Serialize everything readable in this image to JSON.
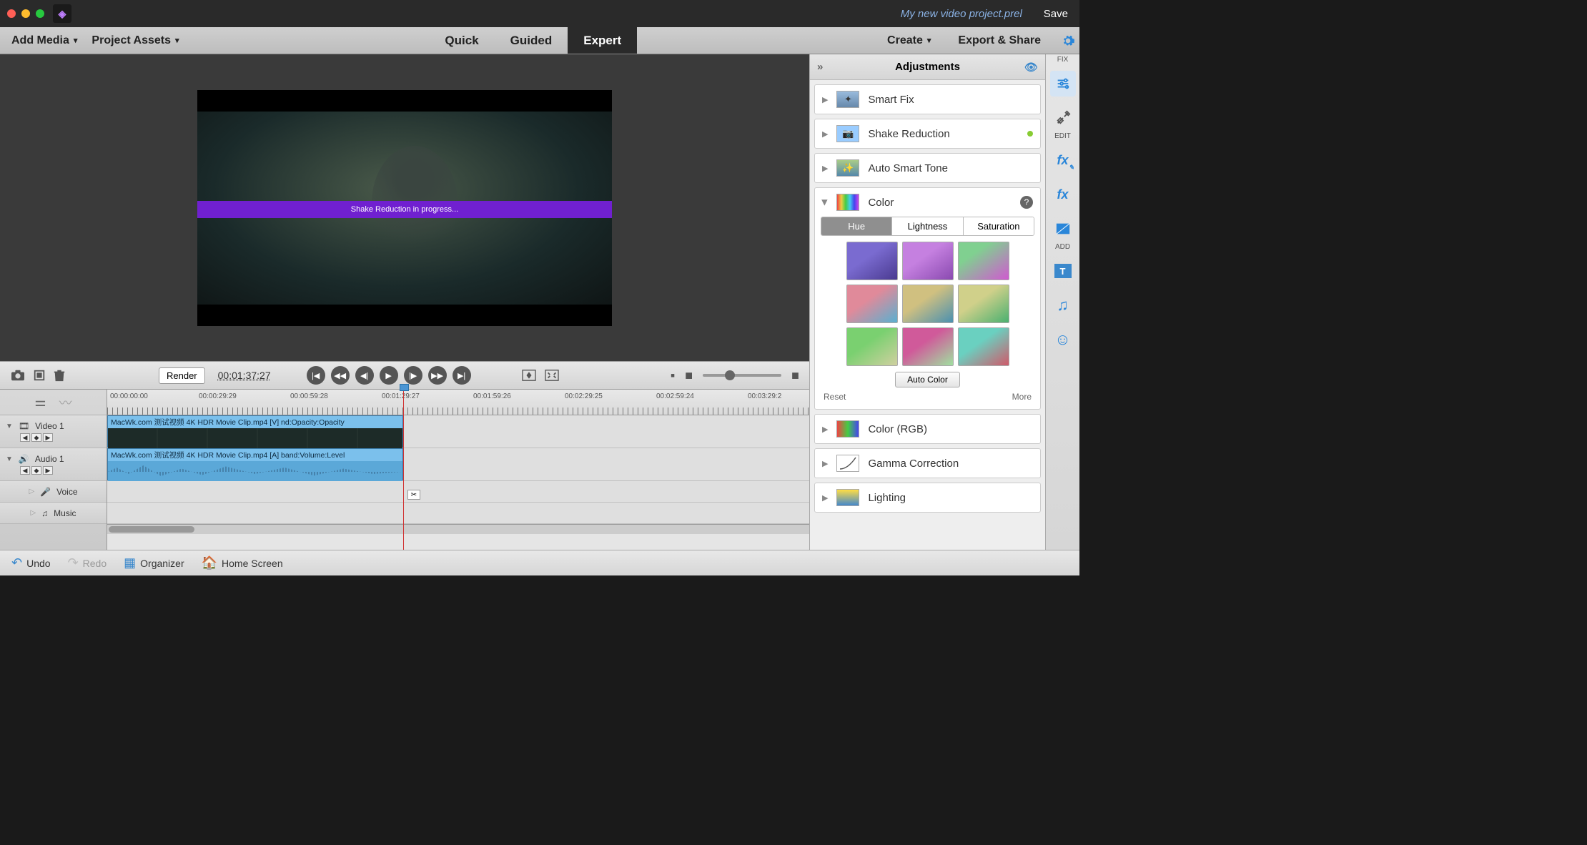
{
  "titlebar": {
    "project_name": "My new video project.prel",
    "save_label": "Save"
  },
  "top": {
    "add_media": "Add Media",
    "project_assets": "Project Assets",
    "modes": {
      "quick": "Quick",
      "guided": "Guided",
      "expert": "Expert",
      "active": "Expert"
    },
    "create": "Create",
    "export": "Export & Share"
  },
  "preview": {
    "shake_message": "Shake Reduction in progress..."
  },
  "transport": {
    "render": "Render",
    "timecode": "00:01:37:27"
  },
  "ruler": [
    "00:00:00:00",
    "00:00:29:29",
    "00:00:59:28",
    "00:01:29:27",
    "00:01:59:26",
    "00:02:29:25",
    "00:02:59:24",
    "00:03:29:2"
  ],
  "tracks": {
    "video1": {
      "name": "Video 1",
      "clip_label": "MacWk.com 测试视频 4K HDR Movie Clip.mp4 [V]  nd:Opacity:Opacity"
    },
    "audio1": {
      "name": "Audio 1",
      "clip_label": "MacWk.com 测试视频 4K HDR Movie Clip.mp4 [A]  band:Volume:Level"
    },
    "voice": {
      "name": "Voice"
    },
    "music": {
      "name": "Music"
    }
  },
  "adjustments": {
    "title": "Adjustments",
    "smart_fix": "Smart Fix",
    "shake_reduction": "Shake Reduction",
    "auto_smart_tone": "Auto Smart Tone",
    "color": {
      "title": "Color",
      "tabs": {
        "hue": "Hue",
        "lightness": "Lightness",
        "saturation": "Saturation"
      },
      "auto_color": "Auto Color",
      "reset": "Reset",
      "more": "More"
    },
    "color_rgb": "Color (RGB)",
    "gamma": "Gamma Correction",
    "lighting": "Lighting"
  },
  "rail": {
    "fix": "FIX",
    "edit": "EDIT",
    "add": "ADD"
  },
  "bottom": {
    "undo": "Undo",
    "redo": "Redo",
    "organizer": "Organizer",
    "home": "Home Screen"
  }
}
